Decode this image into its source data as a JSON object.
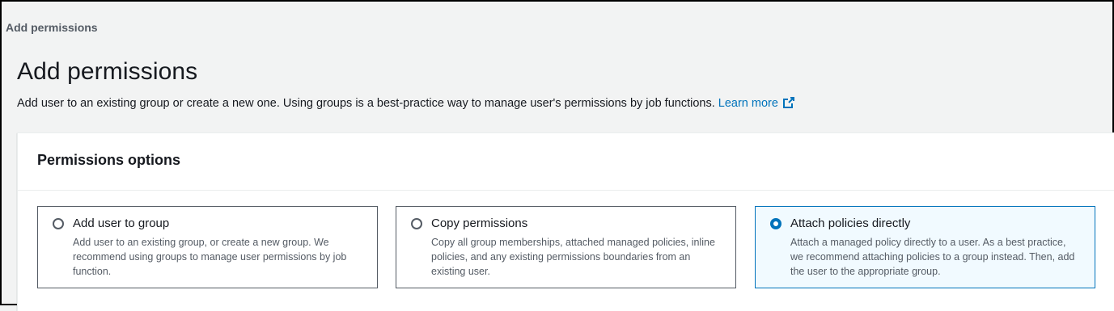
{
  "breadcrumb": "Add permissions",
  "page": {
    "title": "Add permissions",
    "description": "Add user to an existing group or create a new one. Using groups is a best-practice way to manage user's permissions by job functions.",
    "learn_more": "Learn more"
  },
  "panel": {
    "title": "Permissions options"
  },
  "options": [
    {
      "label": "Add user to group",
      "description": "Add user to an existing group, or create a new group. We recommend using groups to manage user permissions by job function.",
      "selected": false
    },
    {
      "label": "Copy permissions",
      "description": "Copy all group memberships, attached managed policies, inline policies, and any existing permissions boundaries from an existing user.",
      "selected": false
    },
    {
      "label": "Attach policies directly",
      "description": "Attach a managed policy directly to a user. As a best practice, we recommend attaching policies to a group instead. Then, add the user to the appropriate group.",
      "selected": true
    }
  ],
  "colors": {
    "accent": "#0073bb",
    "selected_bg": "#f1faff",
    "page_bg": "#f2f3f3"
  }
}
